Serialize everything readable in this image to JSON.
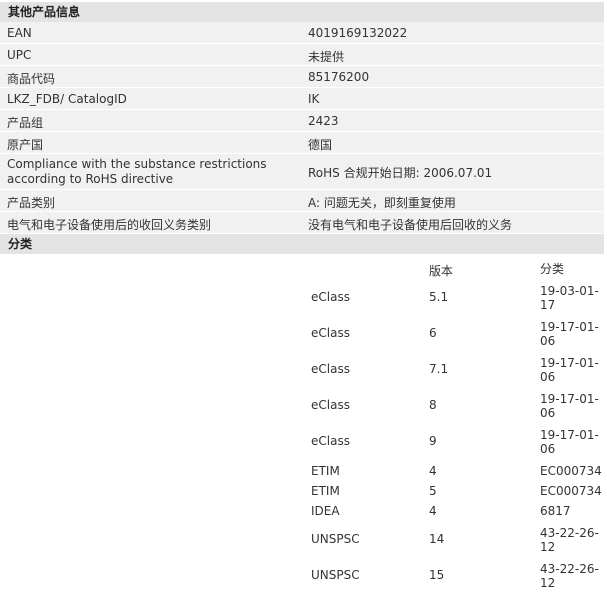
{
  "sections": {
    "info_title": "其他产品信息",
    "classification_title": "分类"
  },
  "info_rows": [
    {
      "key": "EAN",
      "value": "4019169132022"
    },
    {
      "key": "UPC",
      "value": "未提供"
    },
    {
      "key": "商品代码",
      "value": "85176200"
    },
    {
      "key": "LKZ_FDB/ CatalogID",
      "value": "IK"
    },
    {
      "key": "产品组",
      "value": "2423"
    },
    {
      "key": "原产国",
      "value": "德国"
    },
    {
      "key": "Compliance with the substance restrictions according to RoHS directive",
      "value": "RoHS 合规开始日期: 2006.07.01"
    },
    {
      "key": "产品类别",
      "value": "A: 问题无关，即刻重复使用"
    },
    {
      "key": "电气和电子设备使用后的收回义务类别",
      "value": "没有电气和电子设备使用后回收的义务"
    }
  ],
  "classification": {
    "headers": {
      "system": "",
      "version": "版本",
      "class": "分类"
    },
    "rows": [
      {
        "system": "eClass",
        "version": "5.1",
        "class": "19-03-01-17"
      },
      {
        "system": "eClass",
        "version": "6",
        "class": "19-17-01-06"
      },
      {
        "system": "eClass",
        "version": "7.1",
        "class": "19-17-01-06"
      },
      {
        "system": "eClass",
        "version": "8",
        "class": "19-17-01-06"
      },
      {
        "system": "eClass",
        "version": "9",
        "class": "19-17-01-06"
      },
      {
        "system": "ETIM",
        "version": "4",
        "class": "EC000734"
      },
      {
        "system": "ETIM",
        "version": "5",
        "class": "EC000734"
      },
      {
        "system": "IDEA",
        "version": "4",
        "class": "6817"
      },
      {
        "system": "UNSPSC",
        "version": "14",
        "class": "43-22-26-12"
      },
      {
        "system": "UNSPSC",
        "version": "15",
        "class": "43-22-26-12"
      }
    ]
  }
}
